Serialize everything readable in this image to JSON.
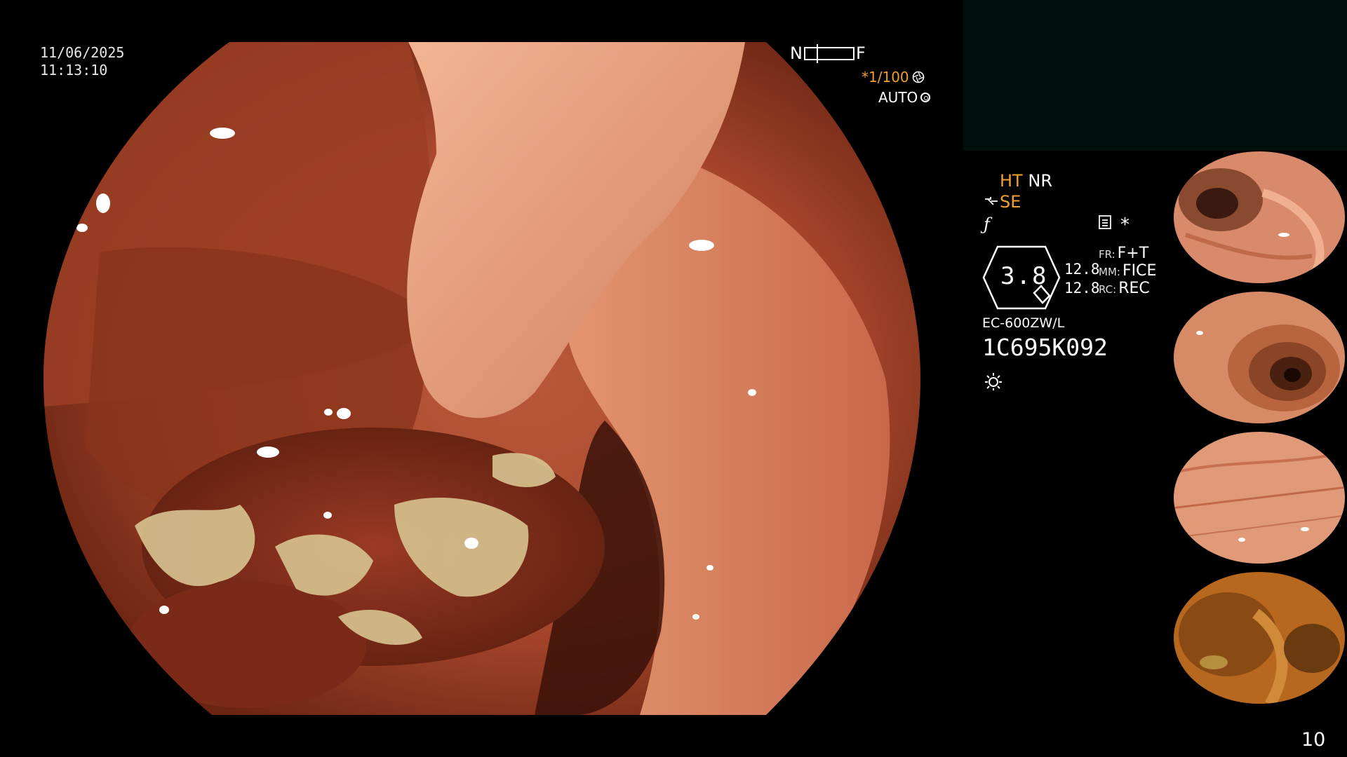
{
  "overlay": {
    "date": "11/06/2025",
    "time": "11:13:10",
    "focus_near": "N",
    "focus_far": "F",
    "shutter": "*1/100",
    "iris": "AUTO"
  },
  "settings": {
    "ht": "HT",
    "nr": "NR",
    "se": "SE",
    "star": "*",
    "zoom": "3.8",
    "value_1": "12.8",
    "value_2": "12.8",
    "fr_label": "FR:",
    "fr_value": "F+T",
    "mm_label": "MM:",
    "mm_value": "FICE",
    "rc_label": "RC:",
    "rc_value": "REC",
    "model": "EC-600ZW/L",
    "serial": "1C695K092"
  },
  "page_number": "10",
  "icons": {
    "shutter": "aperture-icon",
    "iris": "iris-icon",
    "edge": "edge-enhance-icon",
    "structure": "structure-icon",
    "document": "document-icon",
    "light": "light-icon"
  },
  "colors": {
    "accent_orange": "#f0a030",
    "panel_dark": "#00100d"
  }
}
